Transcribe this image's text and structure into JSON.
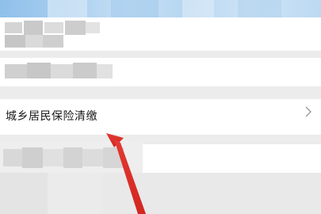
{
  "list": {
    "target_item": {
      "label": "城乡居民保险清缴",
      "icon": "chevron-right-icon"
    }
  },
  "annotation": {
    "icon": "red-arrow-pointer",
    "color": "#e0302a"
  },
  "colors": {
    "header": "#a9cff0",
    "background": "#ececec",
    "item": "#ffffff",
    "text": "#1a1a1a"
  }
}
